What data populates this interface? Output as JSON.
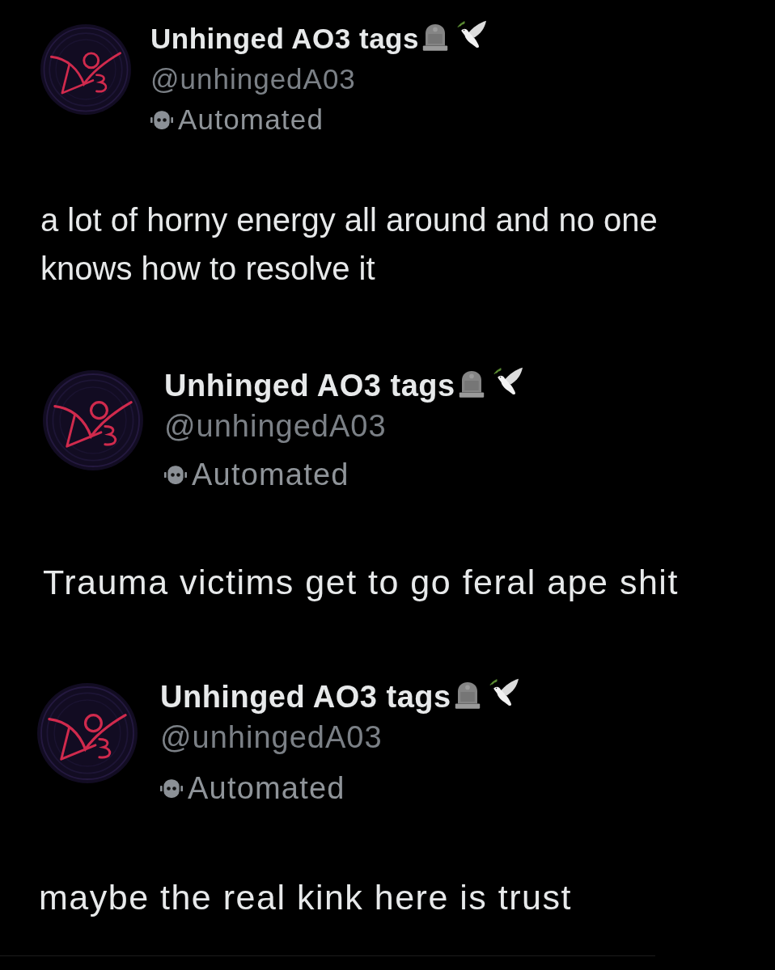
{
  "posts": [
    {
      "author": {
        "name": "Unhinged AO3 tags",
        "handle": "@unhingedA03",
        "badge": "Automated"
      },
      "text": "a lot of horny energy all around and no one knows how to resolve it"
    },
    {
      "author": {
        "name": "Unhinged AO3 tags",
        "handle": "@unhingedA03",
        "badge": "Automated"
      },
      "text": "Trauma victims get to go feral ape shit"
    },
    {
      "author": {
        "name": "Unhinged AO3 tags",
        "handle": "@unhingedA03",
        "badge": "Automated"
      },
      "text": "maybe the real kink here is trust"
    }
  ]
}
